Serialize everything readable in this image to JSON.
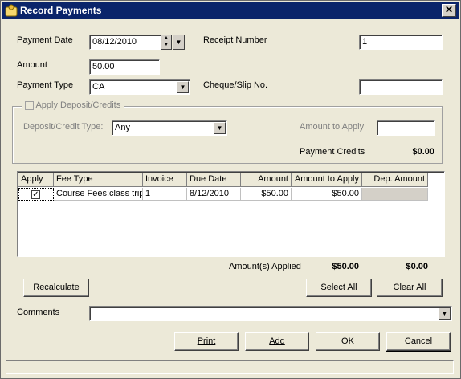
{
  "window": {
    "title": "Record Payments"
  },
  "payment": {
    "date_label": "Payment Date",
    "date_value": "08/12/2010",
    "receipt_label": "Receipt Number",
    "receipt_value": "1",
    "amount_label": "Amount",
    "amount_value": "50.00",
    "type_label": "Payment Type",
    "type_value": "CA",
    "cheque_label": "Cheque/Slip No.",
    "cheque_value": ""
  },
  "deposit": {
    "apply_label": "Apply Deposit/Credits",
    "type_label": "Deposit/Credit Type:",
    "type_value": "Any",
    "amount_label": "Amount to Apply",
    "amount_value": "",
    "credits_label": "Payment Credits",
    "credits_value": "$0.00"
  },
  "grid": {
    "headers": [
      "Apply",
      "Fee Type",
      "Invoice",
      "Due Date",
      "Amount",
      "Amount to Apply",
      "Dep. Amount"
    ],
    "rows": [
      {
        "apply": true,
        "fee_type": "Course Fees:class trip",
        "invoice": "1",
        "due_date": "8/12/2010",
        "amount": "$50.00",
        "amount_to_apply": "$50.00",
        "dep_amount": ""
      }
    ]
  },
  "totals": {
    "label": "Amount(s) Applied",
    "applied": "$50.00",
    "dep": "$0.00"
  },
  "buttons": {
    "recalculate": "Recalculate",
    "select_all": "Select All",
    "clear_all": "Clear All",
    "print": "Print",
    "add": "Add",
    "ok": "OK",
    "cancel": "Cancel"
  },
  "comments": {
    "label": "Comments",
    "value": ""
  },
  "icons": {
    "app": "wallet-icon",
    "close": "close-icon",
    "dropdown": "chevron-down-icon",
    "spin": "spin-icon"
  }
}
